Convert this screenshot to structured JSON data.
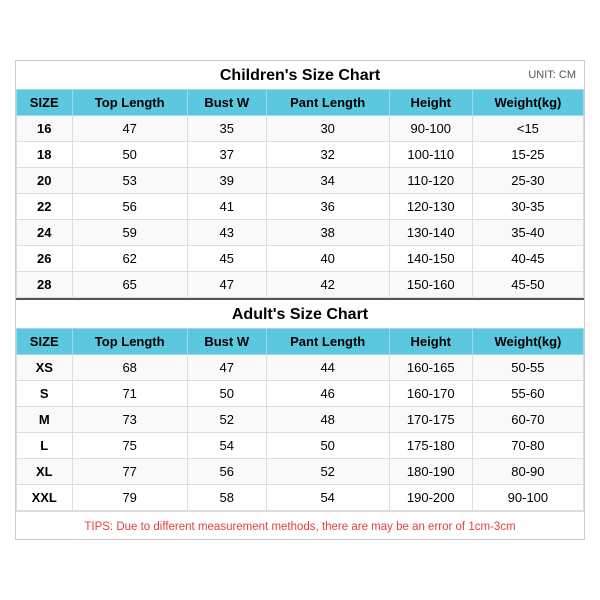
{
  "childrenChart": {
    "title": "Children's Size Chart",
    "unitLabel": "UNIT: CM",
    "headers": [
      "SIZE",
      "Top Length",
      "Bust W",
      "Pant Length",
      "Height",
      "Weight(kg)"
    ],
    "rows": [
      [
        "16",
        "47",
        "35",
        "30",
        "90-100",
        "<15"
      ],
      [
        "18",
        "50",
        "37",
        "32",
        "100-110",
        "15-25"
      ],
      [
        "20",
        "53",
        "39",
        "34",
        "110-120",
        "25-30"
      ],
      [
        "22",
        "56",
        "41",
        "36",
        "120-130",
        "30-35"
      ],
      [
        "24",
        "59",
        "43",
        "38",
        "130-140",
        "35-40"
      ],
      [
        "26",
        "62",
        "45",
        "40",
        "140-150",
        "40-45"
      ],
      [
        "28",
        "65",
        "47",
        "42",
        "150-160",
        "45-50"
      ]
    ]
  },
  "adultChart": {
    "title": "Adult's Size Chart",
    "headers": [
      "SIZE",
      "Top Length",
      "Bust W",
      "Pant Length",
      "Height",
      "Weight(kg)"
    ],
    "rows": [
      [
        "XS",
        "68",
        "47",
        "44",
        "160-165",
        "50-55"
      ],
      [
        "S",
        "71",
        "50",
        "46",
        "160-170",
        "55-60"
      ],
      [
        "M",
        "73",
        "52",
        "48",
        "170-175",
        "60-70"
      ],
      [
        "L",
        "75",
        "54",
        "50",
        "175-180",
        "70-80"
      ],
      [
        "XL",
        "77",
        "56",
        "52",
        "180-190",
        "80-90"
      ],
      [
        "XXL",
        "79",
        "58",
        "54",
        "190-200",
        "90-100"
      ]
    ]
  },
  "tips": "TIPS: Due to different measurement methods, there are may be an error of 1cm-3cm"
}
